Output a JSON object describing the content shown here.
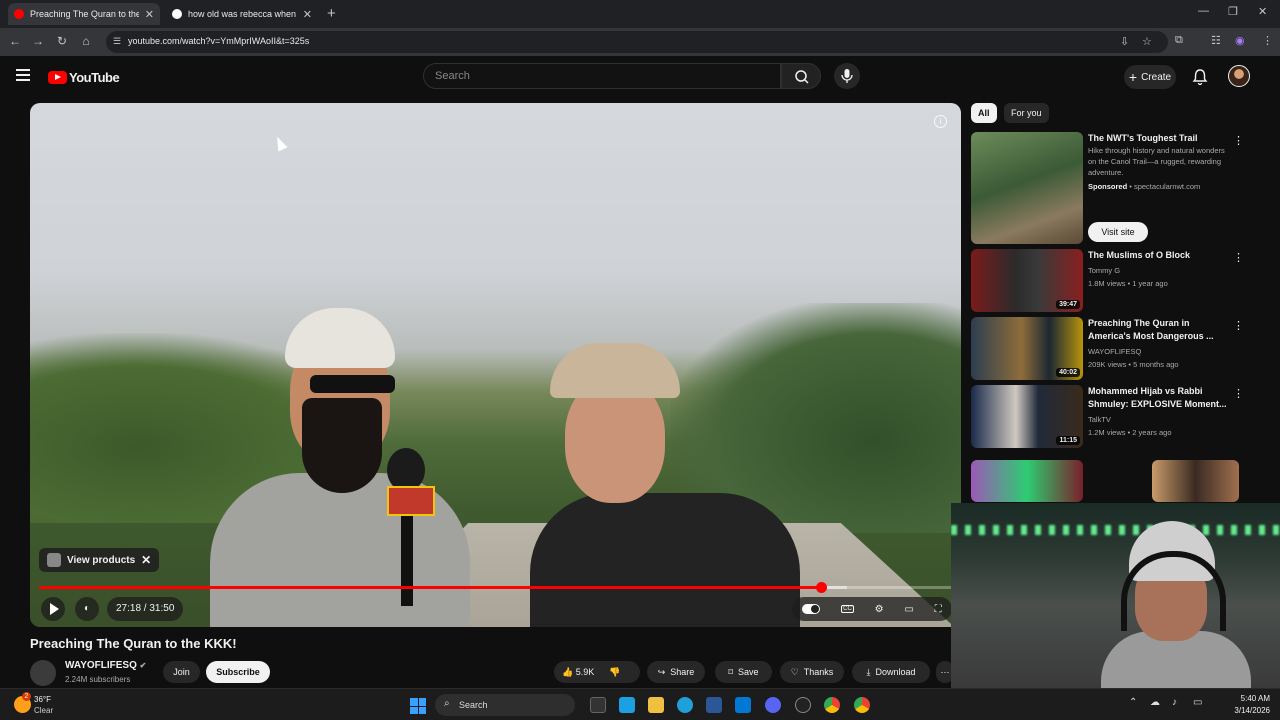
{
  "browser": {
    "tabs": [
      {
        "title": "Preaching The Quran to the KKK",
        "active": true
      },
      {
        "title": "how old was rebecca when she",
        "active": false
      }
    ],
    "url": "youtube.com/watch?v=YmMprIWAoII&t=325s"
  },
  "youtube": {
    "logo": "YouTube",
    "search_placeholder": "Search",
    "create_label": "Create"
  },
  "player": {
    "view_products_label": "View products",
    "time": "27:18 / 31:50",
    "progress": 0.857,
    "buffered": 0.885
  },
  "video": {
    "title": "Preaching The Quran to the KKK!",
    "channel": "WAYOFLIFESQ",
    "subscribers": "2.24M subscribers",
    "join_label": "Join",
    "subscribe_label": "Subscribe",
    "likes": "5.9K",
    "share_label": "Share",
    "save_label": "Save",
    "thanks_label": "Thanks",
    "download_label": "Download"
  },
  "sidebar": {
    "chips": [
      "All",
      "For you"
    ],
    "ad": {
      "title": "The NWT's Toughest Trail",
      "desc": "Hike through history and natural wonders on the Canol Trail—a rugged, rewarding adventure.",
      "sponsored": "Sponsored",
      "advertiser": "spectacularnwt.com",
      "visit_label": "Visit site"
    },
    "recs": [
      {
        "title": "The Muslims of O Block",
        "channel": "Tommy G",
        "stats": "1.8M views • 1 year ago",
        "duration": "39:47"
      },
      {
        "title": "Preaching The Quran in America's Most Dangerous ...",
        "channel": "WAYOFLIFESQ",
        "stats": "209K views • 5 months ago",
        "duration": "40:02"
      },
      {
        "title": "Mohammed Hijab vs Rabbi Shmuley: EXPLOSIVE Moment...",
        "channel": "TalkTV",
        "stats": "1.2M views • 2 years ago",
        "duration": "11:15"
      }
    ]
  },
  "taskbar": {
    "temp": "36°F",
    "condition": "Clear",
    "weather_badge": "2",
    "search_label": "Search",
    "time": "5:40 AM",
    "date": "3/14/2026"
  },
  "colors": {
    "accent": "#ff0000",
    "bg": "#0f0f0f",
    "chip_active": "#f1f1f1"
  }
}
